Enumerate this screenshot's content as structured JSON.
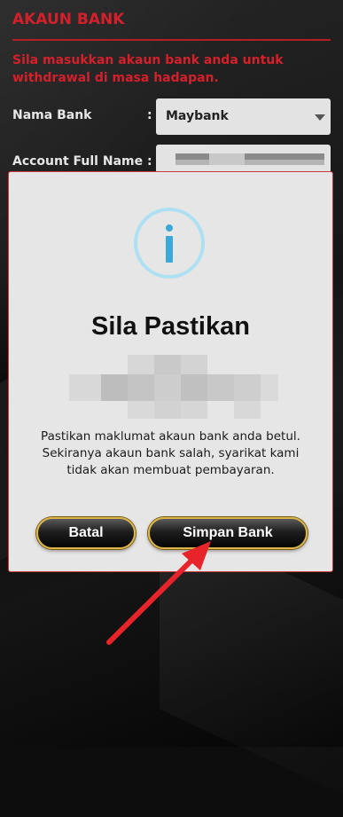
{
  "page": {
    "title": "AKAUN BANK",
    "instructions": "Sila masukkan akaun bank anda untuk withdrawal di masa hadapan."
  },
  "form": {
    "bank_label": "Nama Bank",
    "bank_value": "Maybank",
    "name_label": "Account Full Name :",
    "colon": ":"
  },
  "modal": {
    "title": "Sila Pastikan",
    "message": "Pastikan maklumat akaun bank anda betul. Sekiranya akaun bank salah, syarikat kami tidak akan membuat pembayaran.",
    "cancel_label": "Batal",
    "save_label": "Simpan Bank"
  },
  "colors": {
    "accent_red": "#d4202b",
    "info_blue": "#3aa9d9",
    "button_border_gold": "#d9b54a",
    "arrow_red": "#e8242b"
  }
}
